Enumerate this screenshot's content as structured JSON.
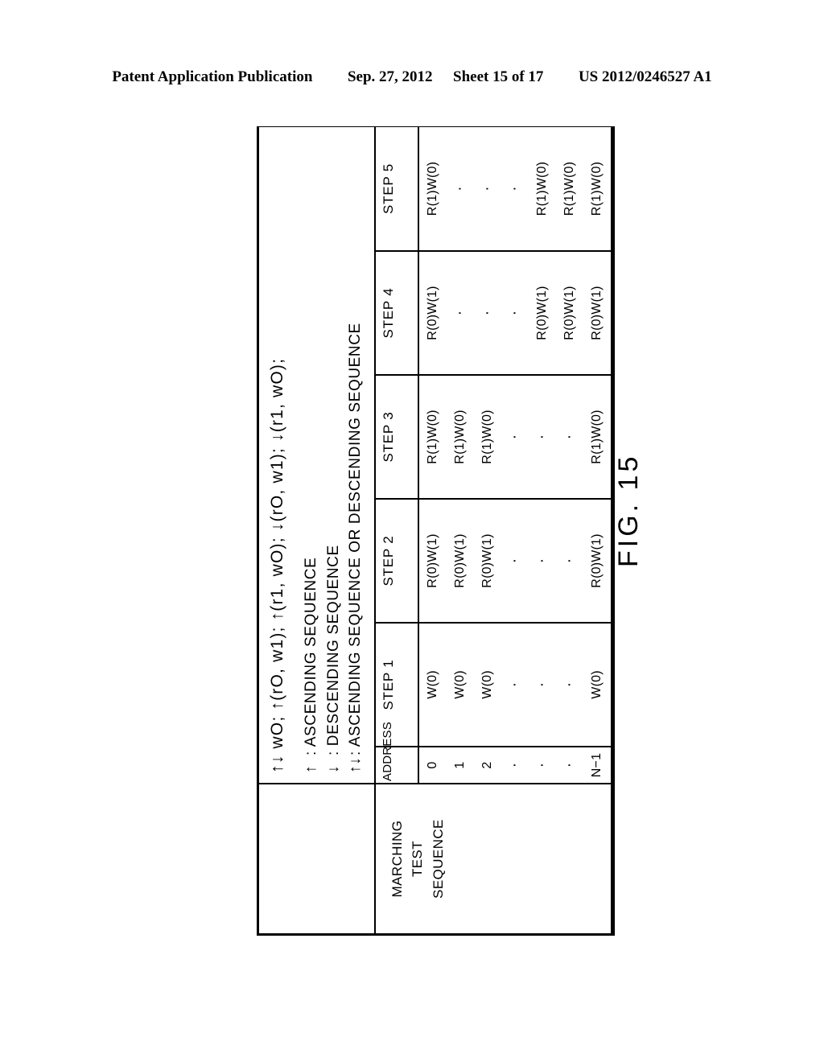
{
  "patent_header": {
    "publication": "Patent Application Publication",
    "date": "Sep. 27, 2012",
    "sheet": "Sheet 15 of 17",
    "number": "US 2012/0246527 A1"
  },
  "figure": {
    "label": "FIG. 15"
  },
  "legend": {
    "formula": "↑↓ wO; ↑(rO, w1); ↑(r1, wO); ↓(rO, w1); ↓(r1, wO);",
    "lines": [
      {
        "arrow": "↑",
        "text": ": ASCENDING SEQUENCE"
      },
      {
        "arrow": "↓",
        "text": ": DESCENDING SEQUENCE"
      },
      {
        "arrow": "↑↓",
        "text": ": ASCENDING SEQUENCE OR DESCENDING SEQUENCE"
      }
    ]
  },
  "table": {
    "row_label": {
      "line1": "MARCHING",
      "line2": "TEST",
      "line3": "SEQUENCE"
    },
    "address_header": "ADDRESS",
    "step_headers": [
      "STEP 1",
      "STEP 2",
      "STEP 3",
      "STEP 4",
      "STEP 5"
    ],
    "addresses": [
      "0",
      "1",
      "2",
      "·",
      "·",
      "·",
      "N−1"
    ],
    "columns": [
      {
        "header": "STEP 1",
        "direction": "ascending",
        "cells": [
          "W(0)",
          "W(0)",
          "W(0)",
          "·",
          "·",
          "·",
          "W(0)"
        ]
      },
      {
        "header": "STEP 2",
        "direction": "ascending",
        "cells": [
          "R(0)W(1)",
          "R(0)W(1)",
          "R(0)W(1)",
          "·",
          "·",
          "·",
          "R(0)W(1)"
        ]
      },
      {
        "header": "STEP 3",
        "direction": "ascending",
        "cells": [
          "R(1)W(0)",
          "R(1)W(0)",
          "R(1)W(0)",
          "·",
          "·",
          "·",
          "R(1)W(0)"
        ]
      },
      {
        "header": "STEP 4",
        "direction": "descending",
        "cells": [
          "R(0)W(1)",
          "·",
          "·",
          "·",
          "R(0)W(1)",
          "R(0)W(1)",
          "R(0)W(1)"
        ]
      },
      {
        "header": "STEP 5",
        "direction": "descending",
        "cells": [
          "R(1)W(0)",
          "·",
          "·",
          "·",
          "R(1)W(0)",
          "R(1)W(0)",
          "R(1)W(0)"
        ]
      }
    ]
  }
}
